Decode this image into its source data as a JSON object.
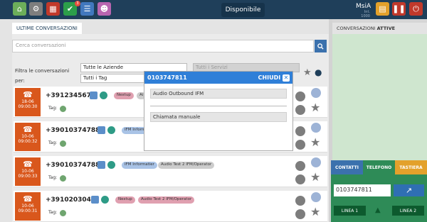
{
  "toolbar": {
    "disponibile": "Disponibile",
    "badge": "3",
    "user_name": "MsiA",
    "user_sub": "Int. 1000",
    "colors": {
      "home": "#6cae5a",
      "gear": "#7e7e7e",
      "calendar": "#c0392b",
      "check": "#2c9e4a",
      "list": "#4178be",
      "contacts": "#b865b0",
      "clip": "#e3a12b",
      "pause": "#c0392b",
      "power": "#c0392b"
    }
  },
  "left": {
    "tab_title": "ULTIME CONVERSAZIONI",
    "search_placeholder": "Cerca conversazioni",
    "filter_label": "Filtra le conversazioni per:",
    "aziende_value": "Tutte le Aziende",
    "servizi_value": "Tutti i Servizi",
    "tag_value": "Tutti i Tag"
  },
  "rows": [
    {
      "number": "+3912345678",
      "date": "18-06",
      "time": "09:00:30",
      "chips": [
        "Nextup",
        "Ai"
      ],
      "tag": "Tag:"
    },
    {
      "number": "+390103747889",
      "date": "10-06",
      "time": "09:00:32",
      "chips": [
        "IFM Informatio"
      ],
      "tag": "Tag:"
    },
    {
      "number": "+390103747889",
      "date": "10-06",
      "time": "09:00:33",
      "chips": [
        "IFM Informatier",
        "Audio Test 2 IFM/Operator"
      ],
      "tag": "Tag:"
    },
    {
      "number": "+3910203040",
      "date": "10-06",
      "time": "09:00:31",
      "chips": [
        "Nextup",
        "Audio Test 2 IFM/Operator"
      ],
      "tag": "Tag:"
    }
  ],
  "modal": {
    "title": "0103747811",
    "close": "CHIUDI",
    "opt1": "Audio Outbound IFM",
    "opt2": "Chiamata manuale"
  },
  "right": {
    "title_prefix": "CONVERSAZIONI",
    "title_strong": "ATTIVE",
    "tab_contatti": "CONTATTI",
    "tab_telefono": "TELEFONO",
    "tab_tastiera": "TASTIERA",
    "phone_number": "0103747811",
    "line1": "LINEA 1",
    "line2": "LINEA 2"
  }
}
